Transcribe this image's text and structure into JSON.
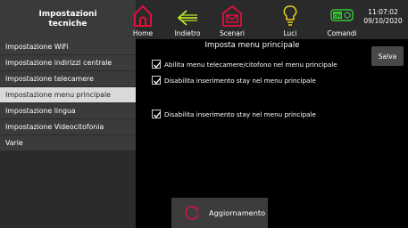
{
  "header": {
    "title_line1": "Impostazioni",
    "title_line2": "tecniche",
    "nav": [
      {
        "label": "Home",
        "icon": "home-icon",
        "color": "#e0103c"
      },
      {
        "label": "Indietro",
        "icon": "arrow-left-icon",
        "color": "#b8e62a"
      },
      {
        "label": "Scenari",
        "icon": "scenario-icon",
        "color": "#e0103c"
      },
      {
        "label": "Luci",
        "icon": "lightbulb-icon",
        "color": "#e6d020"
      },
      {
        "label": "Comandi",
        "icon": "toggle-icon",
        "color": "#38c838",
        "badge": "ON"
      }
    ],
    "time": "11:07:02",
    "date": "09/10/2020"
  },
  "sidebar": {
    "items": [
      {
        "label": "Impostazione WiFi"
      },
      {
        "label": "Impostazione indirizzi centrale"
      },
      {
        "label": "Impostazione telecamere"
      },
      {
        "label": "Impostazione menu principale",
        "active": true
      },
      {
        "label": "Impostazione lingua"
      },
      {
        "label": "Impostazione Videocitofonia"
      },
      {
        "label": "Varie"
      }
    ]
  },
  "main": {
    "title": "Imposta menu principale",
    "save_label": "Salva",
    "options": [
      {
        "label": "Abilita menu telecamere/citofono nel menu principale",
        "checked": true
      },
      {
        "label": "Disabilita inserimento stay nel menu principale",
        "checked": true
      },
      {
        "label": "Disabilita inserimento stay nel menu principale",
        "checked": true
      }
    ],
    "update_label": "Aggiornamento",
    "update_icon_color": "#e0103c"
  }
}
